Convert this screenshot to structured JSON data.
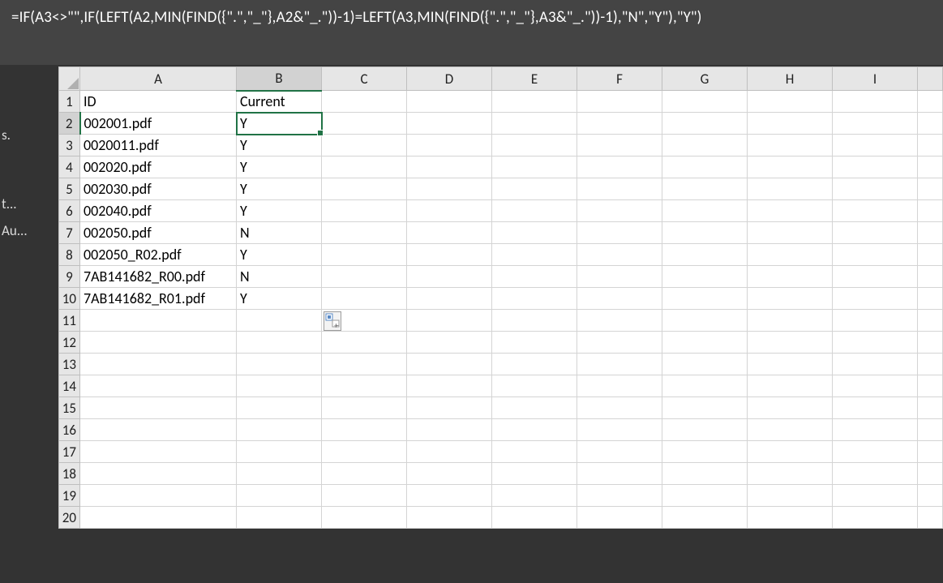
{
  "formula": "=IF(A3<>\"\",IF(LEFT(A2,MIN(FIND({\".\",\"_\"},A2&\"_.\"))-1)=LEFT(A3,MIN(FIND({\".\",\"_\"},A3&\"_.\"))-1),\"N\",\"Y\"),\"Y\")",
  "left_panel": {
    "items": [
      "s.",
      "",
      "t...",
      "Au..."
    ]
  },
  "columns": [
    "A",
    "B",
    "C",
    "D",
    "E",
    "F",
    "G",
    "H",
    "I"
  ],
  "headers": {
    "A": "ID",
    "B": "Current"
  },
  "rows": [
    {
      "n": 1,
      "A": "ID",
      "B": "Current"
    },
    {
      "n": 2,
      "A": "002001.pdf",
      "B": "Y"
    },
    {
      "n": 3,
      "A": "0020011.pdf",
      "B": "Y"
    },
    {
      "n": 4,
      "A": "002020.pdf",
      "B": "Y"
    },
    {
      "n": 5,
      "A": "002030.pdf",
      "B": "Y"
    },
    {
      "n": 6,
      "A": "002040.pdf",
      "B": "Y"
    },
    {
      "n": 7,
      "A": "002050.pdf",
      "B": "N"
    },
    {
      "n": 8,
      "A": "002050_R02.pdf",
      "B": "Y"
    },
    {
      "n": 9,
      "A": "7AB141682_R00.pdf",
      "B": "N"
    },
    {
      "n": 10,
      "A": "7AB141682_R01.pdf",
      "B": "Y"
    },
    {
      "n": 11,
      "A": "",
      "B": ""
    },
    {
      "n": 12,
      "A": "",
      "B": ""
    },
    {
      "n": 13,
      "A": "",
      "B": ""
    },
    {
      "n": 14,
      "A": "",
      "B": ""
    },
    {
      "n": 15,
      "A": "",
      "B": ""
    },
    {
      "n": 16,
      "A": "",
      "B": ""
    },
    {
      "n": 17,
      "A": "",
      "B": ""
    },
    {
      "n": 18,
      "A": "",
      "B": ""
    },
    {
      "n": 19,
      "A": "",
      "B": ""
    },
    {
      "n": 20,
      "A": "",
      "B": ""
    }
  ],
  "selection": {
    "row": 2,
    "col": "B"
  },
  "paste_icon_row": 11,
  "paste_icon_col_after": "B"
}
